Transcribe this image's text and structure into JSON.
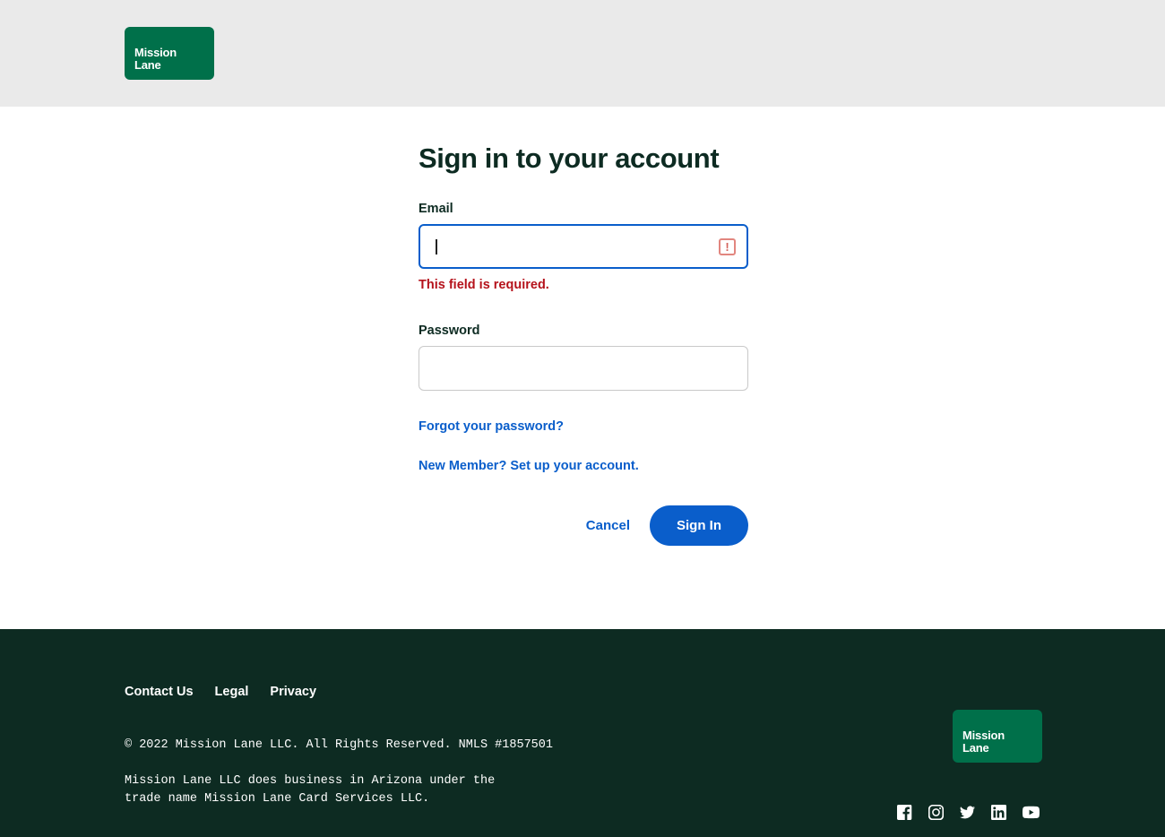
{
  "colors": {
    "brand_green": "#00704a",
    "dark_green": "#0d2b22",
    "link_blue": "#0a5ecb",
    "error_red": "#b5121b",
    "error_icon": "#e2867f",
    "header_bg": "#eaeaea"
  },
  "header": {
    "logo_text": "Mission\nLane"
  },
  "main": {
    "title": "Sign in to your account",
    "email": {
      "label": "Email",
      "value": "",
      "placeholder": "",
      "error": "This field is required.",
      "error_icon_glyph": "!"
    },
    "password": {
      "label": "Password",
      "value": "",
      "placeholder": ""
    },
    "forgot_link": "Forgot your password?",
    "signup_link": "New Member? Set up your account.",
    "cancel_label": "Cancel",
    "signin_label": "Sign In"
  },
  "footer": {
    "links": [
      {
        "label": "Contact Us"
      },
      {
        "label": "Legal"
      },
      {
        "label": "Privacy"
      }
    ],
    "legal": "© 2022 Mission Lane LLC. All Rights Reserved. NMLS #1857501",
    "disclaimer": "Mission Lane LLC does business in Arizona under the\ntrade name Mission Lane Card Services LLC.",
    "logo_text": "Mission\nLane",
    "socials": [
      {
        "name": "facebook"
      },
      {
        "name": "instagram"
      },
      {
        "name": "twitter"
      },
      {
        "name": "linkedin"
      },
      {
        "name": "youtube"
      }
    ]
  }
}
